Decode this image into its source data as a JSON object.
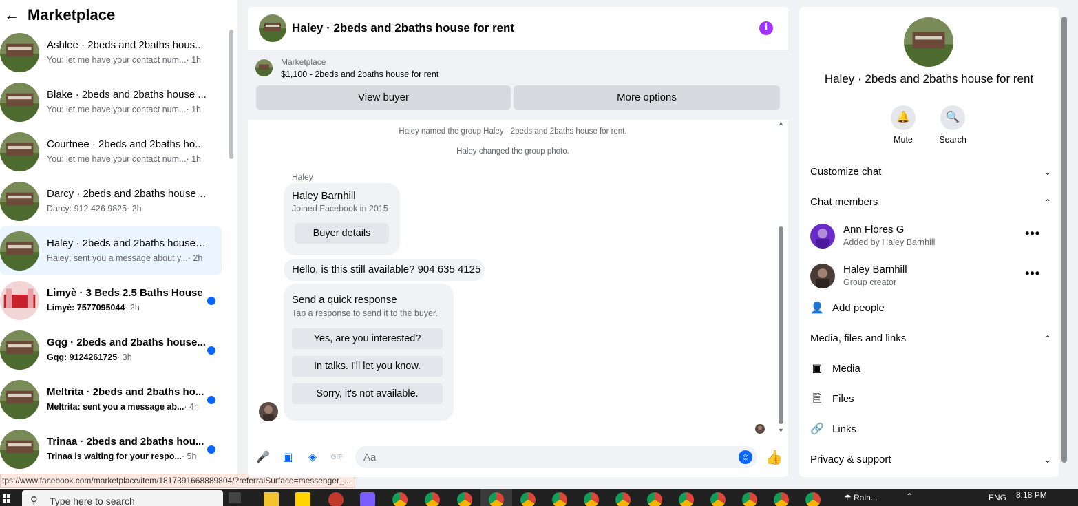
{
  "left": {
    "title": "Marketplace",
    "conversations": [
      {
        "name": "Ashlee · 2beds and 2baths hous...",
        "snippet": "You: let me have your contact num...",
        "time": "· 1h",
        "unread": false,
        "active": false
      },
      {
        "name": "Blake · 2beds and 2baths house ...",
        "snippet": "You: let me have your contact num...",
        "time": "· 1h",
        "unread": false,
        "active": false
      },
      {
        "name": "Courtnee · 2beds and 2baths ho...",
        "snippet": "You: let me have your contact num...",
        "time": "· 1h",
        "unread": false,
        "active": false
      },
      {
        "name": "Darcy · 2beds and 2baths house ...",
        "snippet": "Darcy: 912 426 9825",
        "time": "· 2h",
        "unread": false,
        "active": false
      },
      {
        "name": "Haley · 2beds and 2baths house ...",
        "snippet": "Haley: sent you a message about y...",
        "time": "· 2h",
        "unread": false,
        "active": true
      },
      {
        "name": "Limyè · 3 Beds 2.5 Baths House",
        "snippet": "Limyè: 7577095044",
        "time": "· 2h",
        "unread": true,
        "active": false
      },
      {
        "name": "Gqg · 2beds and 2baths house...",
        "snippet": "Gqg: 9124261725",
        "time": "· 3h",
        "unread": true,
        "active": false
      },
      {
        "name": "Meltrita · 2beds and 2baths ho...",
        "snippet": "Meltrita: sent you a message ab...",
        "time": "· 4h",
        "unread": true,
        "active": false
      },
      {
        "name": "Trinaa · 2beds and 2baths hou...",
        "snippet": "Trinaa is waiting for your respo...",
        "time": "· 5h",
        "unread": true,
        "active": false
      }
    ],
    "status_url": "tps://www.facebook.com/marketplace/item/1817391668889804/?referralSurface=messenger_..."
  },
  "chat": {
    "title": "Haley · 2beds and 2baths house for rent",
    "listing_source": "Marketplace",
    "listing_price": "$1,100 - 2beds and 2baths house for rent",
    "view_buyer": "View buyer",
    "more_options": "More options",
    "sys1": "Haley named the group Haley · 2beds and 2baths house for rent.",
    "sys2": "Haley changed the group photo.",
    "sender": "Haley",
    "card_name": "Haley Barnhill",
    "card_joined": "Joined Facebook in 2015",
    "buyer_details": "Buyer details",
    "message": "Hello, is this still available? 904 635 4125",
    "quick_title": "Send a quick response",
    "quick_sub": "Tap a response to send it to the buyer.",
    "quick_replies": [
      "Yes, are you interested?",
      "In talks. I'll let you know.",
      "Sorry, it's not available."
    ],
    "input_placeholder": "Aa"
  },
  "right": {
    "title": "Haley · 2beds and 2baths house for rent",
    "mute": "Mute",
    "search": "Search",
    "customize": "Customize chat",
    "members_title": "Chat members",
    "members": [
      {
        "name": "Ann Flores G",
        "sub": "Added by Haley Barnhill"
      },
      {
        "name": "Haley Barnhill",
        "sub": "Group creator"
      }
    ],
    "add_people": "Add people",
    "media_title": "Media, files and links",
    "media": "Media",
    "files": "Files",
    "links": "Links",
    "privacy": "Privacy & support"
  },
  "taskbar": {
    "search_placeholder": "Type here to search",
    "weather": "Rain...",
    "lang": "ENG",
    "time": "8:18 PM"
  },
  "colors": {
    "accent": "#0866ff",
    "info": "#a033ff",
    "active_row": "#ebf5ff"
  }
}
